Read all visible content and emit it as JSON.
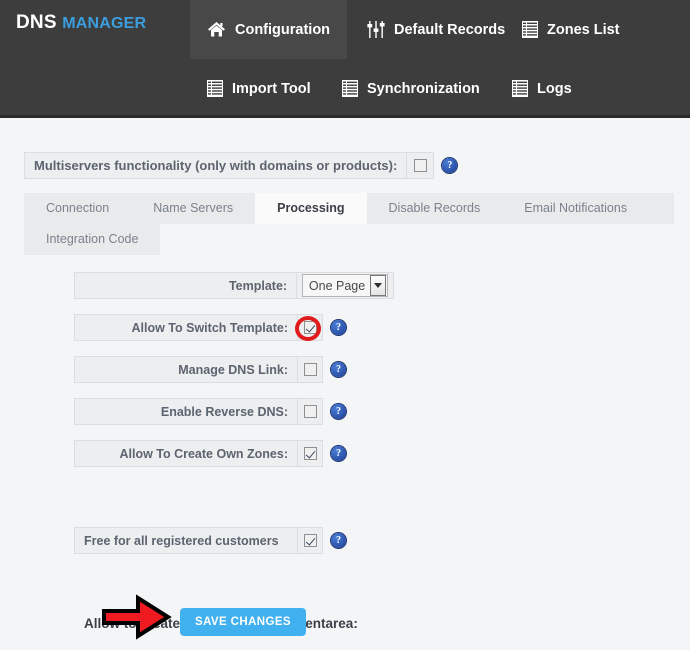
{
  "header": {
    "logo_primary": "DNS",
    "logo_secondary": "MANAGER",
    "nav_row1": [
      {
        "label": "Configuration",
        "icon": "home-icon",
        "active": true
      },
      {
        "label": "Default Records",
        "icon": "sliders-icon",
        "active": false
      },
      {
        "label": "Zones List",
        "icon": "list-icon",
        "active": false
      }
    ],
    "nav_row2": [
      {
        "label": "Import Tool",
        "icon": "list-icon",
        "active": false
      },
      {
        "label": "Synchronization",
        "icon": "list-icon",
        "active": false
      },
      {
        "label": "Logs",
        "icon": "list-icon",
        "active": false
      }
    ]
  },
  "multiservers": {
    "label": "Multiservers functionality (only with domains or products):",
    "checked": false,
    "help": "?"
  },
  "tabs": {
    "row1": [
      {
        "label": "Connection",
        "active": false
      },
      {
        "label": "Name Servers",
        "active": false
      },
      {
        "label": "Processing",
        "active": true
      },
      {
        "label": "Disable Records",
        "active": false
      },
      {
        "label": "Email Notifications",
        "active": false
      }
    ],
    "row2": [
      {
        "label": "Integration Code",
        "active": false
      }
    ]
  },
  "form": {
    "rows": [
      {
        "label": "Template:",
        "type": "select",
        "value": "One Page",
        "help": false
      },
      {
        "label": "Allow To Switch Template:",
        "type": "checkbox",
        "checked": true,
        "help": "?",
        "highlighted": true
      },
      {
        "label": "Manage DNS Link:",
        "type": "checkbox",
        "checked": false,
        "help": "?"
      },
      {
        "label": "Enable Reverse DNS:",
        "type": "checkbox",
        "checked": false,
        "help": "?"
      },
      {
        "label": "Allow To Create Own Zones:",
        "type": "checkbox",
        "checked": true,
        "help": "?"
      }
    ],
    "section_title": "Allow to create own zones from clientarea:",
    "clientarea_row": {
      "label": "Free for all registered customers",
      "checked": true,
      "help": "?"
    }
  },
  "footer": {
    "save_label": "SAVE CHANGES"
  },
  "colors": {
    "header_bg": "#3d3d3d",
    "header_active": "#484848",
    "logo_accent": "#3b9ede",
    "page_bg": "#f4f5f7",
    "field_bg": "#edeef0",
    "save_button": "#41b0ef",
    "highlight_red": "#e01b1b",
    "help_blue": "#2a50a8"
  }
}
